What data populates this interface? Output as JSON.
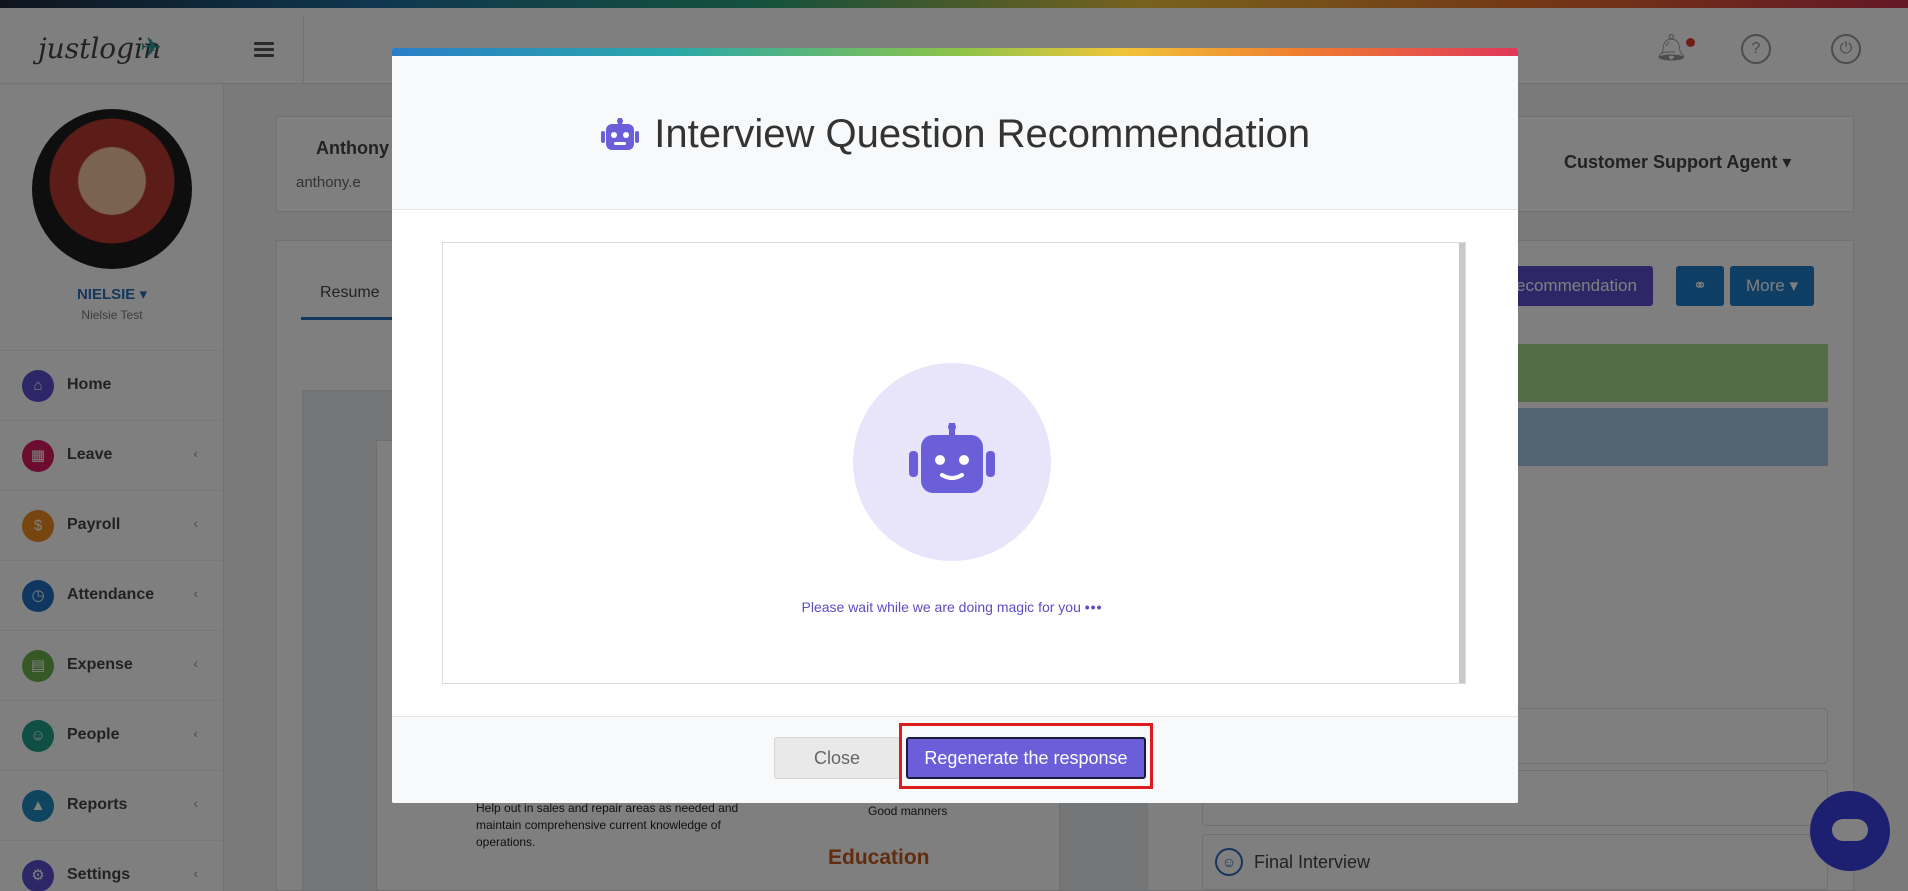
{
  "app": {
    "logo_text": "justlogin",
    "user_name": "NIELSIE ▾",
    "user_sub": "Nielsie Test"
  },
  "sidebar": {
    "items": [
      {
        "label": "Home",
        "icon": "home-icon",
        "color": "#5a4fd0"
      },
      {
        "label": "Leave",
        "icon": "leave-icon",
        "color": "#d81b60"
      },
      {
        "label": "Payroll",
        "icon": "payroll-icon",
        "color": "#ef8b1e"
      },
      {
        "label": "Attendance",
        "icon": "clock-icon",
        "color": "#1e6fbf"
      },
      {
        "label": "Expense",
        "icon": "expense-icon",
        "color": "#6ab04c"
      },
      {
        "label": "People",
        "icon": "people-icon",
        "color": "#1e9e8a"
      },
      {
        "label": "Reports",
        "icon": "reports-icon",
        "color": "#1e8bbf"
      },
      {
        "label": "Settings",
        "icon": "gear-icon",
        "color": "#5a4fd0"
      }
    ]
  },
  "background": {
    "candidate_name": "Anthony",
    "candidate_email": "anthony.e",
    "tab_resume": "Resume",
    "job_title": "Customer Support Agent ▾",
    "btn_recommendation": "ecommendation",
    "btn_more": "More ▾",
    "stage_final_interview": "Final Interview",
    "doc_bullet": "Help out in sales and repair areas as needed and maintain comprehensive current knowledge of operations.",
    "doc_manners": "Good manners",
    "doc_education": "Education"
  },
  "modal": {
    "title": "Interview Question Recommendation",
    "wait_text": "Please wait  while we are doing magic for you",
    "wait_dots": "•••",
    "close_label": "Close",
    "regenerate_label": "Regenerate the response",
    "accent_color": "#6a5fd8"
  }
}
